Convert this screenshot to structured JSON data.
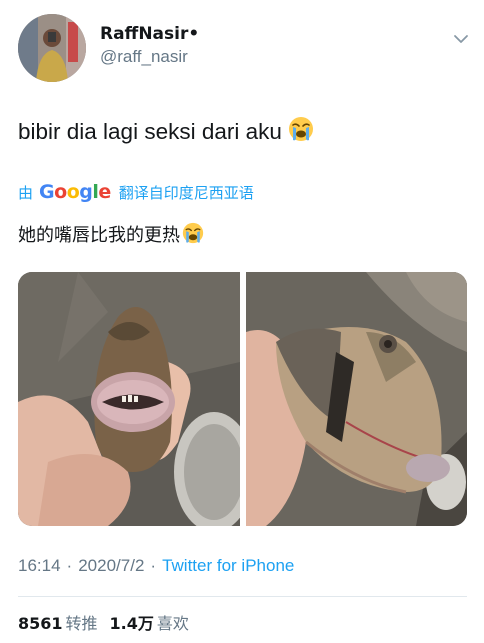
{
  "author": {
    "display_name": "RaffNasir•",
    "handle": "@raff_nasir",
    "avatar_icon": "user-avatar"
  },
  "tweet": {
    "text": "bibir dia lagi seksi dari aku",
    "emoji": "loudly-crying-face"
  },
  "translation": {
    "by_label": "由",
    "provider": "Google",
    "provider_letters": [
      "G",
      "o",
      "o",
      "g",
      "l",
      "e"
    ],
    "action_label": "翻译自印度尼西亚语",
    "translated_text": "她的嘴唇比我的更热"
  },
  "media": [
    {
      "name": "fish-lips-photo-front"
    },
    {
      "name": "fish-lips-photo-side"
    }
  ],
  "meta": {
    "time": "16:14",
    "separator": "·",
    "date": "2020/7/2",
    "source": "Twitter for iPhone"
  },
  "stats": {
    "retweets_count": "8561",
    "retweets_label": "转推",
    "likes_count": "1.4万",
    "likes_label": "喜欢"
  },
  "colors": {
    "link_blue": "#1da1f2",
    "secondary_gray": "#657786",
    "text_dark": "#14171a",
    "divider": "#e1e8ed"
  }
}
